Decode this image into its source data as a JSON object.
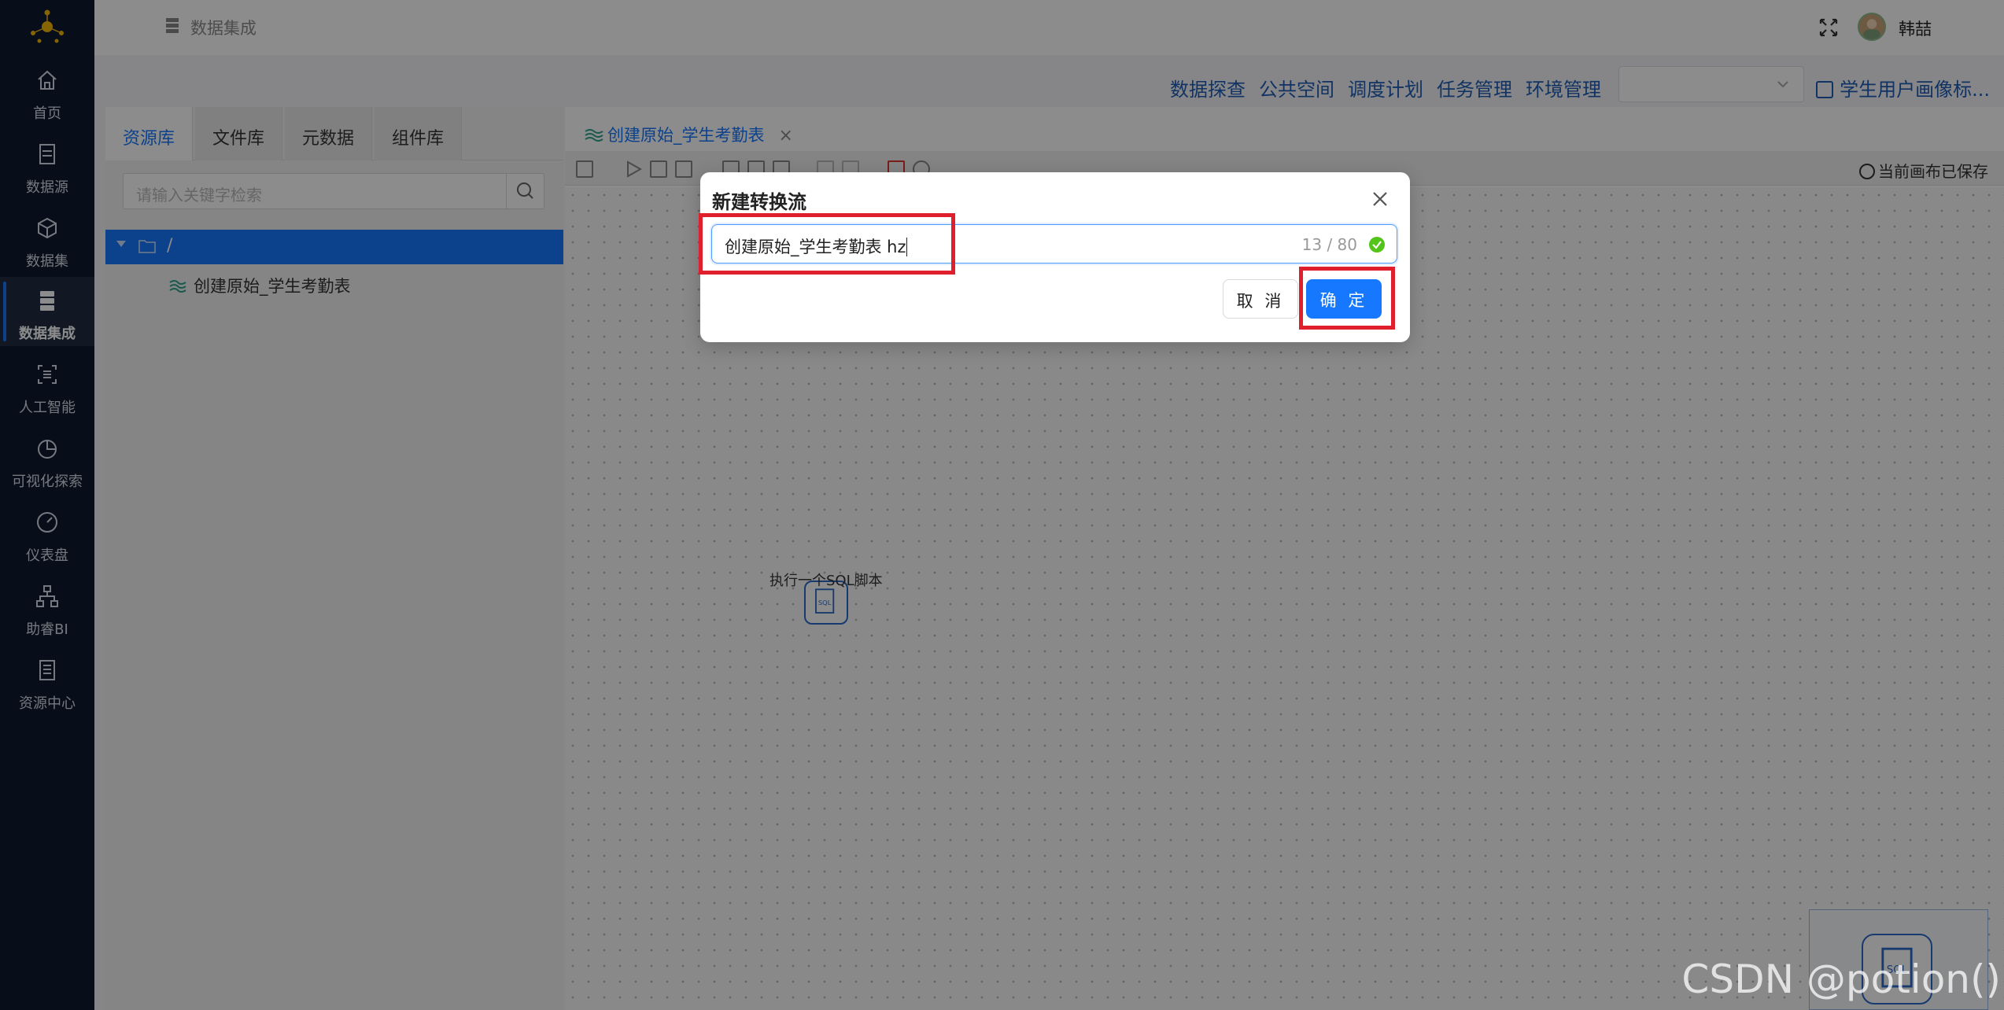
{
  "sidebar": {
    "items": [
      {
        "label": "首页",
        "icon": "home-icon"
      },
      {
        "label": "数据源",
        "icon": "datasource-icon"
      },
      {
        "label": "数据集",
        "icon": "cube-icon"
      },
      {
        "label": "数据集成",
        "icon": "database-icon"
      },
      {
        "label": "人工智能",
        "icon": "ai-scan-icon"
      },
      {
        "label": "可视化探索",
        "icon": "pie-chart-icon"
      },
      {
        "label": "仪表盘",
        "icon": "gauge-icon"
      },
      {
        "label": "助睿BI",
        "icon": "org-chart-icon"
      },
      {
        "label": "资源中心",
        "icon": "document-icon"
      }
    ],
    "active_item": "数据集成"
  },
  "header": {
    "breadcrumb": "数据集成",
    "username": "韩喆"
  },
  "top_menu": {
    "links": [
      "数据探查",
      "公共空间",
      "调度计划",
      "任务管理",
      "环境管理"
    ],
    "env_select_value": "",
    "project": "学生用户画像标..."
  },
  "left_panel": {
    "tabs": [
      "资源库",
      "文件库",
      "元数据",
      "组件库"
    ],
    "active_tab": "资源库",
    "search_placeholder": "请输入关键字检索",
    "tree_root": "/",
    "tree_items": [
      "创建原始_学生考勤表"
    ]
  },
  "editor": {
    "tab_title": "创建原始_学生考勤表",
    "save_status": "当前画布已保存",
    "node_label": "执行一个SQL脚本",
    "node_icon_text": "SQL"
  },
  "modal": {
    "title": "新建转换流",
    "input_value": "创建原始_学生考勤表 hz",
    "char_count": "13 / 80",
    "cancel_label": "取 消",
    "ok_label": "确 定"
  },
  "watermark": "CSDN @potion()",
  "colors": {
    "sidebar_bg": "#0e1b2e",
    "primary": "#1677ff",
    "highlight_red": "#e01f2c",
    "link_blue": "#1f5eb5"
  }
}
